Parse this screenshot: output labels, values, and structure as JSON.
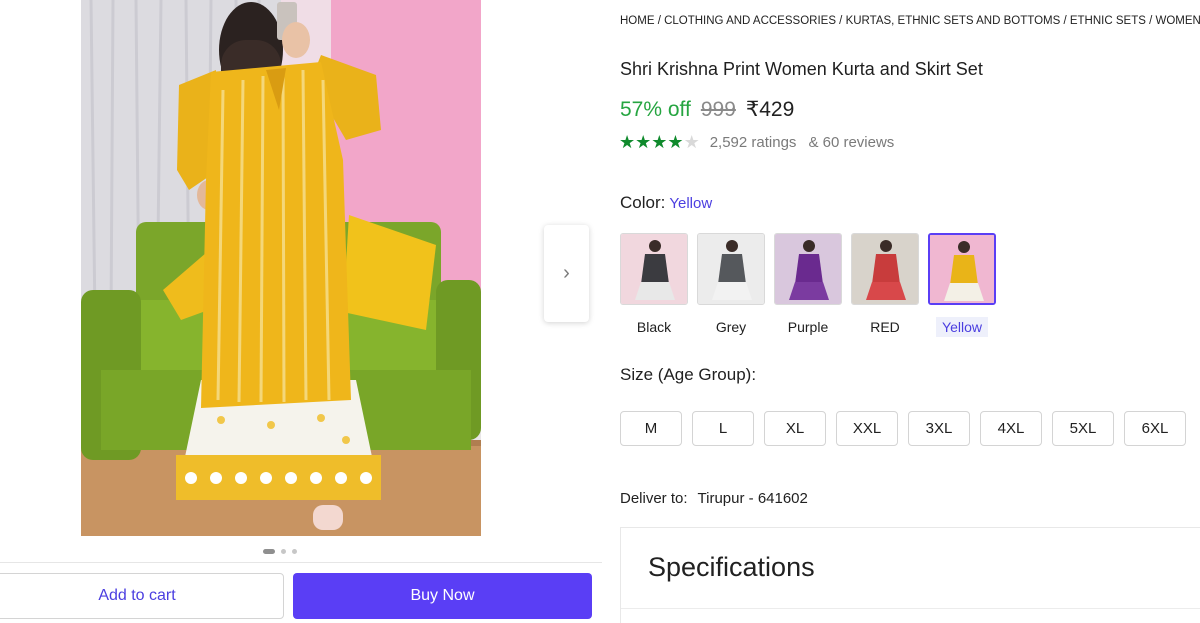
{
  "gallery": {
    "image_alt": "Yellow printed kurta with white and yellow skirt",
    "dots": [
      true,
      false,
      false
    ]
  },
  "actions": {
    "add_to_cart": "Add to cart",
    "buy_now": "Buy Now"
  },
  "breadcrumb": "HOME / CLOTHING AND ACCESSORIES / KURTAS, ETHNIC SETS AND BOTTOMS / ETHNIC SETS / WOMEN'S ETHNIC SETS",
  "product": {
    "title": "Shri Krishna Print Women Kurta and Skirt Set",
    "discount": "57% off",
    "mrp": "999",
    "price": "₹429",
    "rating_stars": 4,
    "ratings": "2,592 ratings",
    "reviews": "& 60 reviews"
  },
  "color": {
    "label": "Color:",
    "selected": "Yellow",
    "options": [
      {
        "name": "Black",
        "kurta": "#3b3b40",
        "skirt": "#e8e8e8",
        "bg": "#f1d7de"
      },
      {
        "name": "Grey",
        "kurta": "#55585c",
        "skirt": "#f2f2f2",
        "bg": "#ececec"
      },
      {
        "name": "Purple",
        "kurta": "#6a2a8f",
        "skirt": "#7b3ba0",
        "bg": "#d9c7dd"
      },
      {
        "name": "RED",
        "kurta": "#c83c3c",
        "skirt": "#d8484a",
        "bg": "#d8d3cb"
      },
      {
        "name": "Yellow",
        "kurta": "#e9b418",
        "skirt": "#f3f0e6",
        "bg": "#f0b7d1"
      }
    ]
  },
  "size": {
    "label": "Size (Age Group):",
    "options": [
      "M",
      "L",
      "XL",
      "XXL",
      "3XL",
      "4XL",
      "5XL",
      "6XL"
    ]
  },
  "delivery": {
    "label": "Deliver to:",
    "value": "Tirupur - 641602"
  },
  "specifications": {
    "title": "Specifications"
  },
  "colors": {
    "accent": "#5a3ef5",
    "discount_green": "#26a541",
    "star_green": "#0f8a2c"
  }
}
